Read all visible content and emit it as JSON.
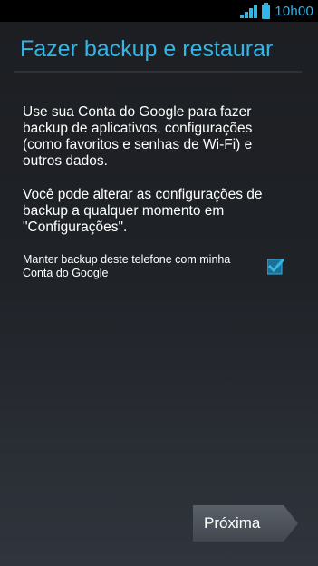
{
  "status_bar": {
    "time": "10h00",
    "icons": [
      "signal-icon",
      "battery-icon"
    ],
    "accent_color": "#33b5e5"
  },
  "header": {
    "title": "Fazer backup e restaurar"
  },
  "content": {
    "paragraph_1": "Use sua Conta do Google para fazer backup de aplicativos, configurações (como favoritos e senhas de Wi-Fi) e outros dados.",
    "paragraph_2": "Você pode alterar as configurações de backup a qualquer momento em \"Configurações\"."
  },
  "backup_option": {
    "label": "Manter backup deste telefone com minha Conta do Google",
    "checked": true
  },
  "footer": {
    "next_label": "Próxima"
  }
}
